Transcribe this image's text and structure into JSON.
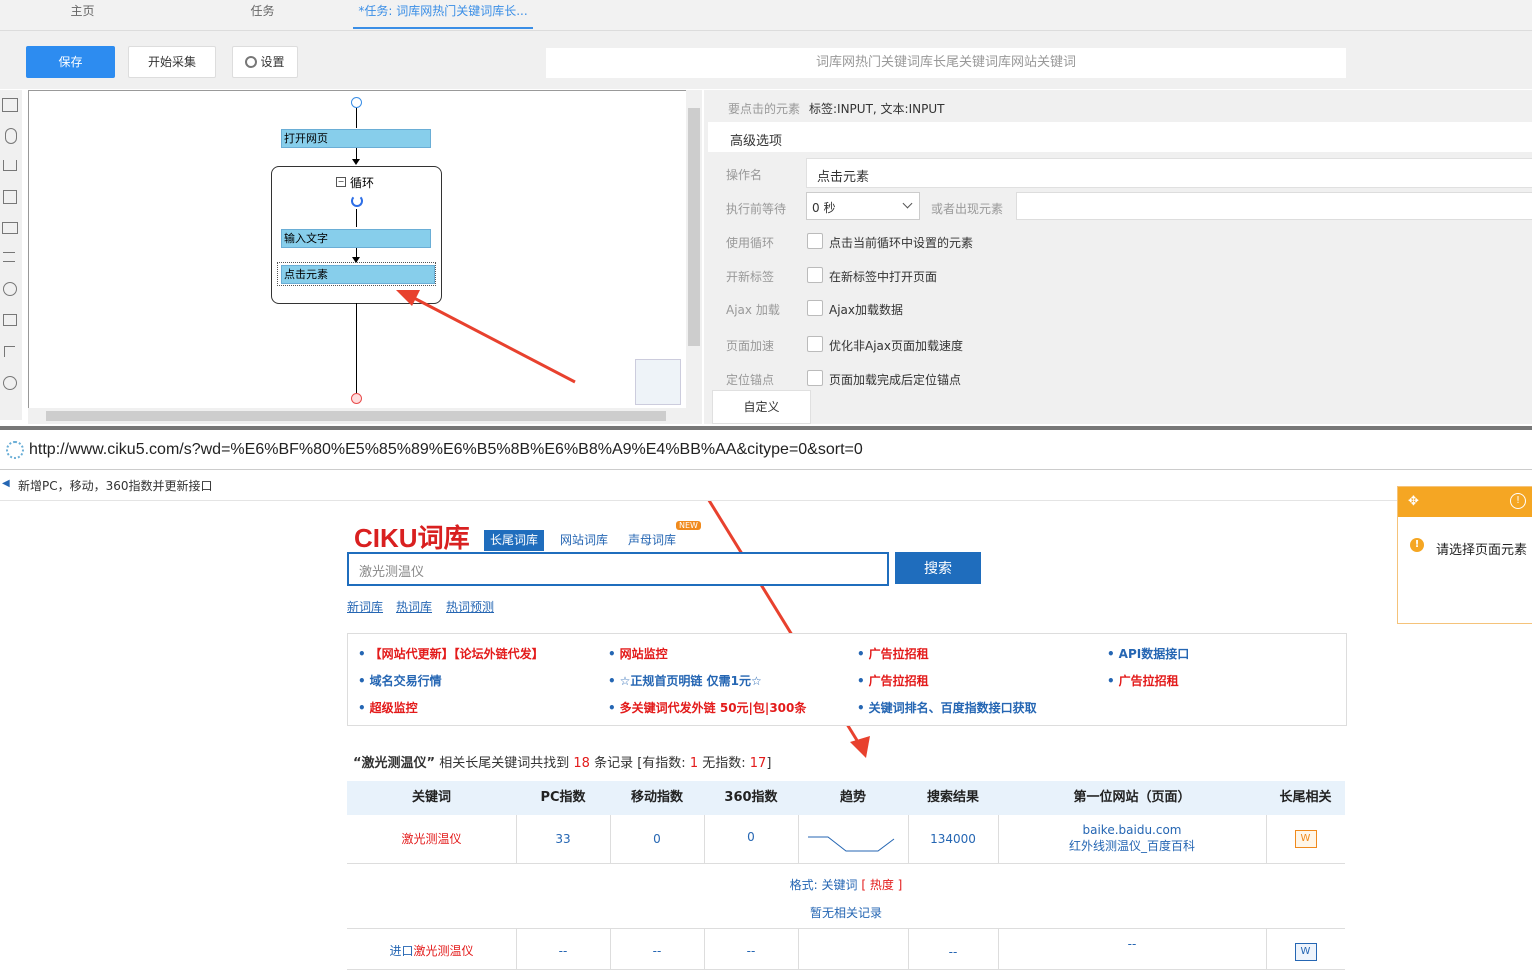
{
  "tabs": [
    {
      "label": "主页"
    },
    {
      "label": "任务"
    },
    {
      "label": "*任务: 词库网热门关键词库长..."
    }
  ],
  "toolbar": {
    "save": "保存",
    "start": "开始采集",
    "settings": "设置",
    "task_title": "词库网热门关键词库长尾关键词库网站关键词"
  },
  "flow": {
    "open_page": "打开网页",
    "loop": "循环",
    "input_text": "输入文字",
    "click_element": "点击元素"
  },
  "props": {
    "target_label": "要点击的元素",
    "target_value": "标签:INPUT, 文本:INPUT",
    "advanced": "高级选项",
    "op_name_label": "操作名",
    "op_name_value": "点击元素",
    "wait_label": "执行前等待",
    "wait_value": "0 秒",
    "or_appear_label": "或者出现元素",
    "use_loop_label": "使用循环",
    "use_loop_text": "点击当前循环中设置的元素",
    "new_tab_label": "开新标签",
    "new_tab_text": "在新标签中打开页面",
    "ajax_label": "Ajax 加载",
    "ajax_text": "Ajax加载数据",
    "speed_label": "页面加速",
    "speed_text": "优化非Ajax页面加载速度",
    "anchor_label": "定位锚点",
    "anchor_text": "页面加载完成后定位锚点",
    "custom": "自定义"
  },
  "browser": {
    "url": "http://www.ciku5.com/s?wd=%E6%BF%80%E5%85%89%E6%B5%8B%E6%B8%A9%E4%BB%AA&citype=0&sort=0",
    "notice": "新增PC，移动，360指数并更新接口"
  },
  "popup": {
    "message": "请选择页面元素"
  },
  "site": {
    "logo_ciku": "CIKU",
    "logo_cn": "词库",
    "nav": [
      "长尾词库",
      "网站词库",
      "声母词库"
    ],
    "new_badge": "NEW",
    "search_value": "激光测温仪",
    "search_button": "搜索",
    "sublinks": [
      "新词库",
      "热词库",
      "热词预测"
    ],
    "ads": [
      {
        "text": "【网站代更新】【论坛外链代发】",
        "color": "red"
      },
      {
        "text": "网站监控",
        "color": "red"
      },
      {
        "text": "广告拉招租",
        "color": "red"
      },
      {
        "text": "API数据接口",
        "color": "blue"
      },
      {
        "text": "域名交易行情",
        "color": "blue"
      },
      {
        "text": "☆正规首页明链 仅需1元☆",
        "color": "blue"
      },
      {
        "text": "广告拉招租",
        "color": "red"
      },
      {
        "text": "广告拉招租",
        "color": "red"
      },
      {
        "text": "超级监控",
        "color": "red"
      },
      {
        "text": "多关键词代发外链 50元|包|300条",
        "color": "red"
      },
      {
        "text": "关键词排名、百度指数接口获取",
        "color": "blue"
      }
    ],
    "summary": {
      "keyword": "“激光测温仪”",
      "text1": "相关长尾关键词共找到",
      "total": "18",
      "text2": "条记录 [有指数:",
      "with_index": "1",
      "text3": "无指数:",
      "without_index": "17",
      "text4": "]"
    },
    "table": {
      "headers": [
        "关键词",
        "PC指数",
        "移动指数",
        "360指数",
        "趋势",
        "搜索结果",
        "第一位网站（页面）",
        "长尾相关"
      ],
      "row1": {
        "keyword": "激光测温仪",
        "pc": "33",
        "mobile": "0",
        "i360": "0",
        "results": "134000",
        "site": "baike.baidu.com",
        "page": "红外线测温仪_百度百科"
      },
      "format_prefix": "格式:",
      "format_kw": "关键词",
      "format_hot": "[ 热度 ]",
      "no_related": "暂无相关记录",
      "row2": {
        "keyword_prefix": "进口",
        "keyword_main": "激光测温仪",
        "pc": "--",
        "mobile": "--",
        "i360": "--",
        "results": "--",
        "site": "--"
      }
    }
  }
}
